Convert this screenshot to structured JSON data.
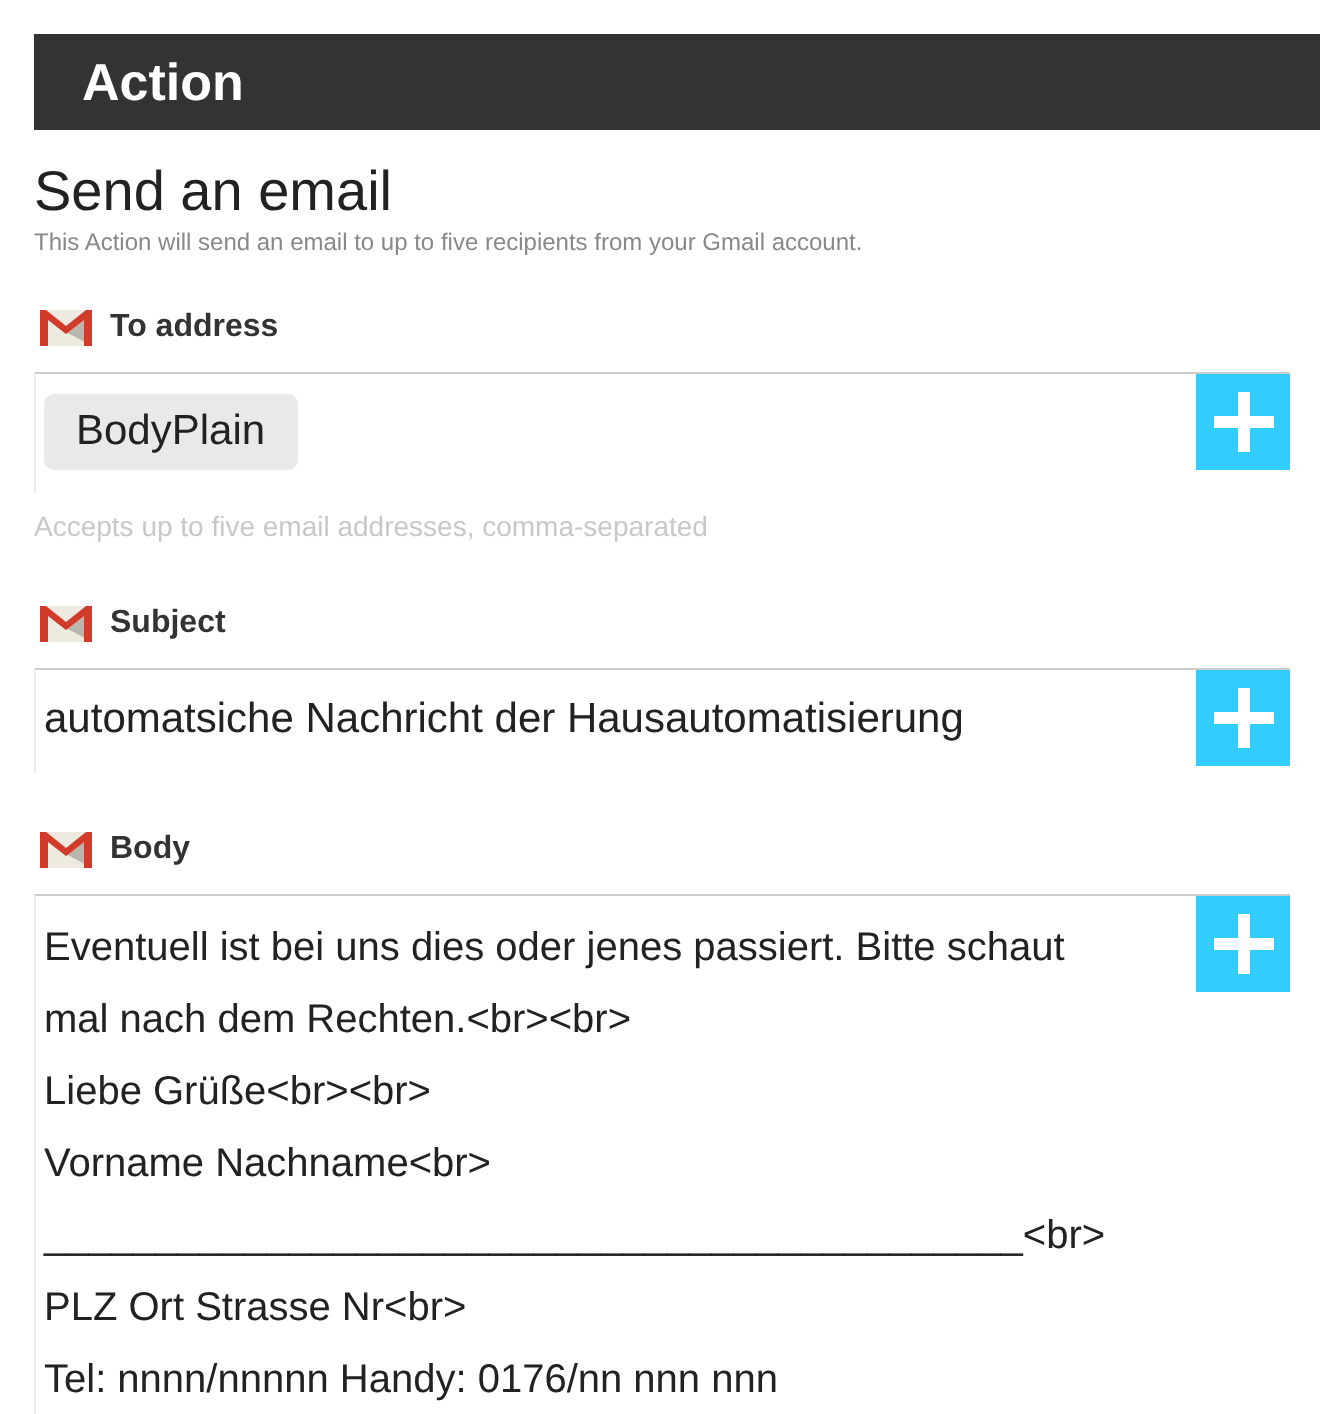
{
  "header": {
    "title": "Action"
  },
  "action": {
    "title": "Send an email",
    "description": "This Action will send an email to up to five recipients from your Gmail account."
  },
  "fields": [
    {
      "label": "To address",
      "kind": "tokens",
      "tokens": [
        "BodyPlain"
      ],
      "help": "Accepts up to five email addresses, comma-separated"
    },
    {
      "label": "Subject",
      "kind": "text",
      "value": "automatsiche Nachricht der Hausautomatisierung"
    },
    {
      "label": "Body",
      "kind": "multiline",
      "lines": [
        "Eventuell ist bei uns dies oder jenes passiert. Bitte schaut mal nach dem Rechten.<br><br>",
        "Liebe Grüße<br><br>",
        "Vorname Nachname<br>",
        "____________________________________________<br>",
        "PLZ Ort Strasse Nr<br>",
        "Tel: nnnn/nnnnn Handy: 0176/nn nnn nnn"
      ]
    }
  ]
}
